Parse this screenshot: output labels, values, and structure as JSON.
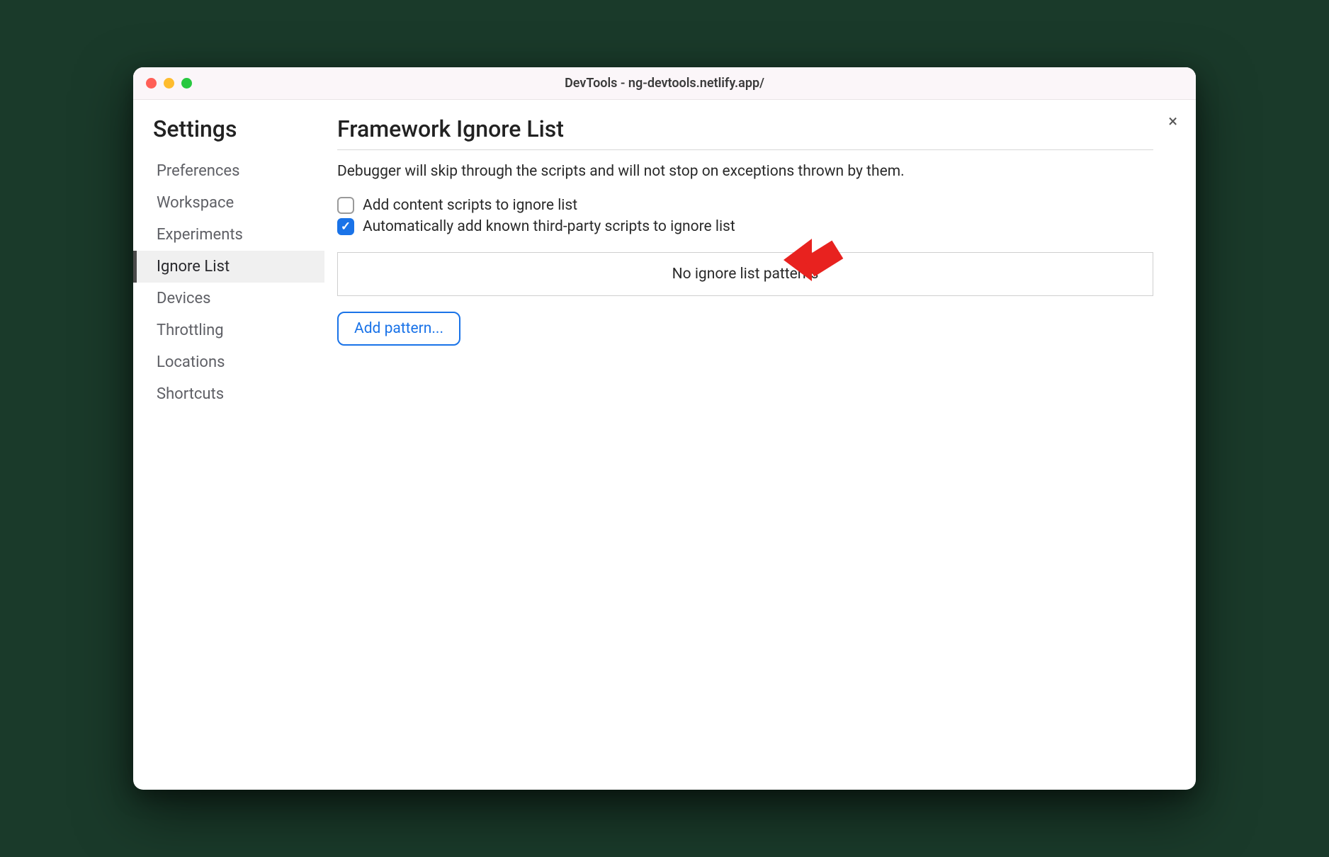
{
  "window": {
    "title": "DevTools - ng-devtools.netlify.app/"
  },
  "sidebar": {
    "title": "Settings",
    "items": [
      {
        "label": "Preferences",
        "active": false
      },
      {
        "label": "Workspace",
        "active": false
      },
      {
        "label": "Experiments",
        "active": false
      },
      {
        "label": "Ignore List",
        "active": true
      },
      {
        "label": "Devices",
        "active": false
      },
      {
        "label": "Throttling",
        "active": false
      },
      {
        "label": "Locations",
        "active": false
      },
      {
        "label": "Shortcuts",
        "active": false
      }
    ]
  },
  "main": {
    "title": "Framework Ignore List",
    "description": "Debugger will skip through the scripts and will not stop on exceptions thrown by them.",
    "checkbox1": {
      "label": "Add content scripts to ignore list",
      "checked": false
    },
    "checkbox2": {
      "label": "Automatically add known third-party scripts to ignore list",
      "checked": true
    },
    "empty_patterns": "No ignore list patterns",
    "add_pattern_label": "Add pattern..."
  },
  "close_label": "×"
}
